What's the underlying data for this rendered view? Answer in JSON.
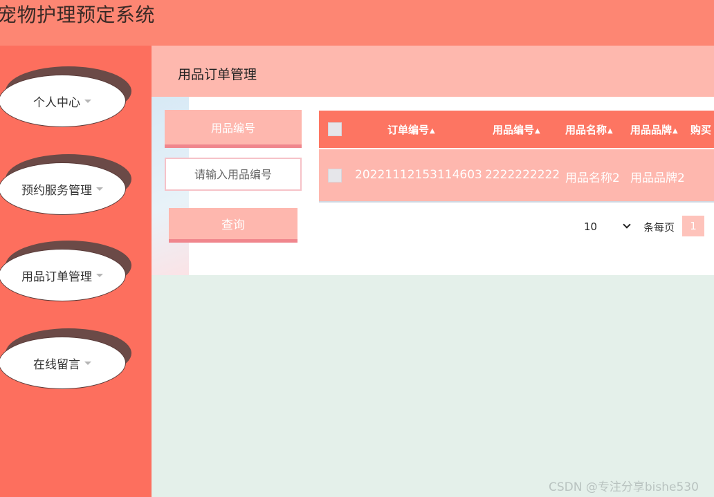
{
  "app": {
    "title": "宠物护理预定系统"
  },
  "sidebar": {
    "items": [
      {
        "label": "个人中心"
      },
      {
        "label": "预约服务管理"
      },
      {
        "label": "用品订单管理"
      },
      {
        "label": "在线留言"
      }
    ]
  },
  "page": {
    "title": "用品订单管理"
  },
  "filter": {
    "label": "用品编号",
    "placeholder": "请输入用品编号",
    "query_button": "查询"
  },
  "table": {
    "columns": [
      "订单编号",
      "用品编号",
      "用品名称",
      "用品品牌",
      "购买"
    ],
    "rows": [
      {
        "order_no": "20221112153114603",
        "item_no": "2222222222",
        "item_name": "用品名称2",
        "item_brand": "用品品牌2"
      }
    ],
    "sort_icon": "sort-icon"
  },
  "pagination": {
    "page_size": "10",
    "per_page_label": "条每页",
    "current_page": "1"
  },
  "watermark": "CSDN @专注分享bishe530",
  "colors": {
    "topbar": "#fd8673",
    "sidebar": "#fd6f5e",
    "header_band": "#feb8ae",
    "table_header": "#fd7562",
    "table_row": "#feb7ae",
    "background": "#e4f0ea"
  }
}
